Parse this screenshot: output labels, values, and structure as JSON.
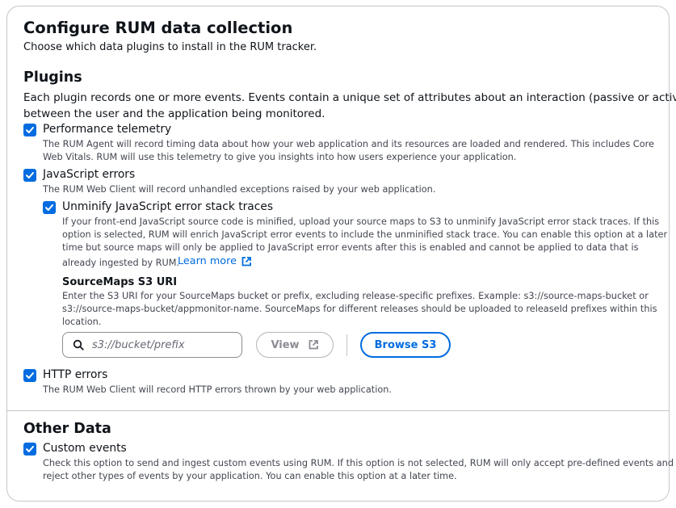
{
  "header": {
    "title": "Configure RUM data collection",
    "subtitle": "Choose which data plugins to install in the RUM tracker."
  },
  "plugins": {
    "title": "Plugins",
    "intro_line1": "Each plugin records one or more events. Events contain a unique set of attributes about an interaction (passive or active)",
    "intro_line2": "between the user and the application being monitored.",
    "performance": {
      "label": "Performance telemetry",
      "checked": true,
      "desc_line1": "The RUM Agent will record timing data about how your web application and its resources are loaded and rendered. This includes Core",
      "desc_line2": "Web Vitals. RUM will use this telemetry to give you insights into how users experience your application."
    },
    "js_errors": {
      "label": "JavaScript errors",
      "checked": true,
      "desc": "The RUM Web Client will record unhandled exceptions raised by your web application."
    },
    "unminify": {
      "label": "Unminify JavaScript error stack traces",
      "checked": true,
      "desc_line1": "If your front-end JavaScript source code is minified, upload your source maps to S3 to unminify JavaScript error stack traces. If this",
      "desc_line2": "option is selected, RUM will enrich JavaScript error events to include the unminified stack trace. You can enable this option at a later",
      "desc_line3": "time but source maps will only be applied to JavaScript error events after this is enabled and cannot be applied to data that is",
      "desc_line4": "already ingested by RUM.",
      "learn_more": "Learn more"
    },
    "sourcemaps": {
      "label": "SourceMaps S3 URI",
      "desc_line1": "Enter the S3 URI for your SourceMaps bucket or prefix, excluding release-specific prefixes. Example: s3://source-maps-bucket or",
      "desc_line2": "s3://source-maps-bucket/appmonitor-name. SourceMaps for different releases should be uploaded to releaseId prefixes within this",
      "desc_line3": "location.",
      "placeholder": "s3://bucket/prefix",
      "value": "",
      "view_label": "View",
      "browse_label": "Browse S3"
    },
    "http_errors": {
      "label": "HTTP errors",
      "checked": true,
      "desc": "The RUM Web Client will record HTTP errors thrown by your web application."
    }
  },
  "other": {
    "title": "Other Data",
    "custom_events": {
      "label": "Custom events",
      "checked": true,
      "desc_line1": "Check this option to send and ingest custom events using RUM. If this option is not selected, RUM will only accept pre-defined events and",
      "desc_line2": "reject other types of events by your application. You can enable this option at a later time."
    }
  },
  "colors": {
    "accent": "#006ce0",
    "text": "#0f141a",
    "secondary_text": "#424650",
    "border": "#c6c6cd"
  },
  "icons": [
    "check-icon",
    "search-icon",
    "external-link-icon"
  ]
}
